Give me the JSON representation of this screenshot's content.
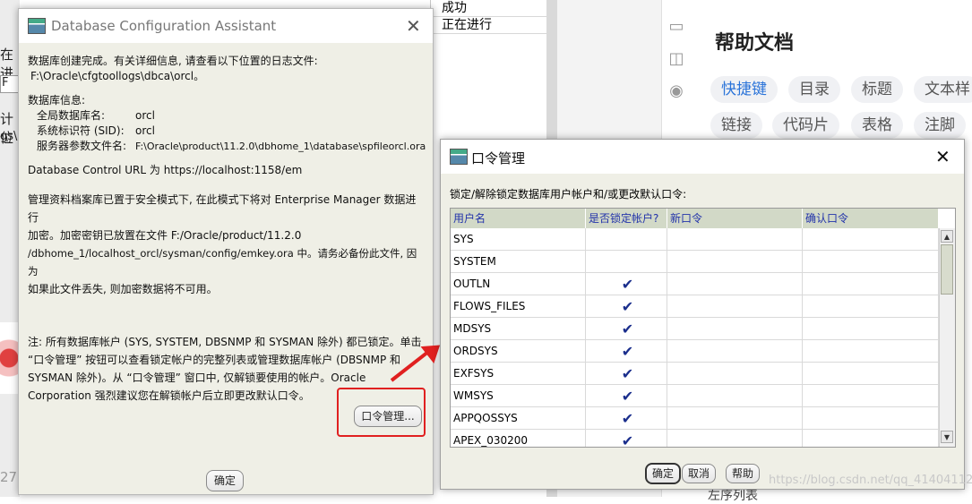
{
  "background": {
    "left_fragments": [
      "在进",
      "F",
      "计位",
      "gs\\c",
      "279"
    ],
    "status_rows": [
      "成功",
      "正在进行"
    ],
    "help_title": "帮助文档",
    "help_chips": [
      "快捷键",
      "目录",
      "标题",
      "文本样",
      "链接",
      "代码片",
      "表格",
      "注脚"
    ],
    "bottom_text": "左序列表",
    "watermark": "https://blog.csdn.net/qq_41404112"
  },
  "dbca": {
    "title": "Database Configuration Assistant",
    "line1": "数据库创建完成。有关详细信息, 请查看以下位置的日志文件:",
    "line2": "F:\\Oracle\\cfgtoollogs\\dbca\\orcl。",
    "db_info_label": "数据库信息:",
    "info": [
      {
        "k": "全局数据库名:",
        "v": "orcl"
      },
      {
        "k": "系统标识符 (SID):",
        "v": "orcl"
      },
      {
        "k": "服务器参数文件名:",
        "v": "F:\\Oracle\\product\\11.2.0\\dbhome_1\\database\\spfileorcl.ora"
      }
    ],
    "url_line": "Database Control URL 为 https://localhost:1158/em",
    "store_lines": [
      "管理资料档案库已置于安全模式下, 在此模式下将对 Enterprise Manager 数据进行",
      "加密。加密密钥已放置在文件 F:/Oracle/product/11.2.0",
      "/dbhome_1/localhost_orcl/sysman/config/emkey.ora 中。请务必备份此文件, 因为",
      "如果此文件丢失, 则加密数据将不可用。"
    ],
    "note_lines": [
      "注: 所有数据库帐户 (SYS, SYSTEM, DBSNMP 和 SYSMAN 除外) 都已锁定。单击",
      "“口令管理” 按钮可以查看锁定帐户的完整列表或管理数据库帐户 (DBSNMP 和",
      "SYSMAN 除外)。从 “口令管理” 窗口中, 仅解锁要使用的帐户。Oracle",
      "Corporation 强烈建议您在解锁帐户后立即更改默认口令。"
    ],
    "pwd_button": "口令管理...",
    "ok_button": "确定"
  },
  "pwd": {
    "title": "口令管理",
    "desc": "锁定/解除锁定数据库用户帐户和/或更改默认口令:",
    "columns": [
      "用户名",
      "是否锁定帐户?",
      "新口令",
      "确认口令"
    ],
    "rows": [
      {
        "user": "SYS",
        "locked": false
      },
      {
        "user": "SYSTEM",
        "locked": false
      },
      {
        "user": "OUTLN",
        "locked": true
      },
      {
        "user": "FLOWS_FILES",
        "locked": true
      },
      {
        "user": "MDSYS",
        "locked": true
      },
      {
        "user": "ORDSYS",
        "locked": true
      },
      {
        "user": "EXFSYS",
        "locked": true
      },
      {
        "user": "WMSYS",
        "locked": true
      },
      {
        "user": "APPQOSSYS",
        "locked": true
      },
      {
        "user": "APEX_030200",
        "locked": true
      }
    ],
    "ok": "确定",
    "cancel": "取消",
    "help": "帮助"
  },
  "colors": {
    "highlight": "#e02020",
    "grid_header": "#d2d9c7",
    "check": "#1a2e8c",
    "link_chip": "#2b74d9"
  }
}
